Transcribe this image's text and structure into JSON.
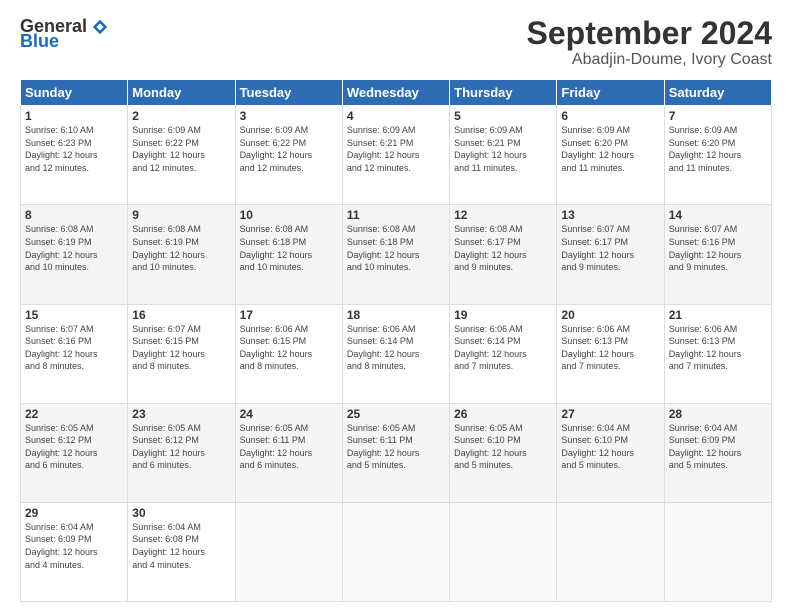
{
  "logo": {
    "general": "General",
    "blue": "Blue"
  },
  "title": "September 2024",
  "subtitle": "Abadjin-Doume, Ivory Coast",
  "days_header": [
    "Sunday",
    "Monday",
    "Tuesday",
    "Wednesday",
    "Thursday",
    "Friday",
    "Saturday"
  ],
  "weeks": [
    [
      {
        "day": "1",
        "info": "Sunrise: 6:10 AM\nSunset: 6:23 PM\nDaylight: 12 hours\nand 12 minutes."
      },
      {
        "day": "2",
        "info": "Sunrise: 6:09 AM\nSunset: 6:22 PM\nDaylight: 12 hours\nand 12 minutes."
      },
      {
        "day": "3",
        "info": "Sunrise: 6:09 AM\nSunset: 6:22 PM\nDaylight: 12 hours\nand 12 minutes."
      },
      {
        "day": "4",
        "info": "Sunrise: 6:09 AM\nSunset: 6:21 PM\nDaylight: 12 hours\nand 12 minutes."
      },
      {
        "day": "5",
        "info": "Sunrise: 6:09 AM\nSunset: 6:21 PM\nDaylight: 12 hours\nand 11 minutes."
      },
      {
        "day": "6",
        "info": "Sunrise: 6:09 AM\nSunset: 6:20 PM\nDaylight: 12 hours\nand 11 minutes."
      },
      {
        "day": "7",
        "info": "Sunrise: 6:09 AM\nSunset: 6:20 PM\nDaylight: 12 hours\nand 11 minutes."
      }
    ],
    [
      {
        "day": "8",
        "info": "Sunrise: 6:08 AM\nSunset: 6:19 PM\nDaylight: 12 hours\nand 10 minutes."
      },
      {
        "day": "9",
        "info": "Sunrise: 6:08 AM\nSunset: 6:19 PM\nDaylight: 12 hours\nand 10 minutes."
      },
      {
        "day": "10",
        "info": "Sunrise: 6:08 AM\nSunset: 6:18 PM\nDaylight: 12 hours\nand 10 minutes."
      },
      {
        "day": "11",
        "info": "Sunrise: 6:08 AM\nSunset: 6:18 PM\nDaylight: 12 hours\nand 10 minutes."
      },
      {
        "day": "12",
        "info": "Sunrise: 6:08 AM\nSunset: 6:17 PM\nDaylight: 12 hours\nand 9 minutes."
      },
      {
        "day": "13",
        "info": "Sunrise: 6:07 AM\nSunset: 6:17 PM\nDaylight: 12 hours\nand 9 minutes."
      },
      {
        "day": "14",
        "info": "Sunrise: 6:07 AM\nSunset: 6:16 PM\nDaylight: 12 hours\nand 9 minutes."
      }
    ],
    [
      {
        "day": "15",
        "info": "Sunrise: 6:07 AM\nSunset: 6:16 PM\nDaylight: 12 hours\nand 8 minutes."
      },
      {
        "day": "16",
        "info": "Sunrise: 6:07 AM\nSunset: 6:15 PM\nDaylight: 12 hours\nand 8 minutes."
      },
      {
        "day": "17",
        "info": "Sunrise: 6:06 AM\nSunset: 6:15 PM\nDaylight: 12 hours\nand 8 minutes."
      },
      {
        "day": "18",
        "info": "Sunrise: 6:06 AM\nSunset: 6:14 PM\nDaylight: 12 hours\nand 8 minutes."
      },
      {
        "day": "19",
        "info": "Sunrise: 6:06 AM\nSunset: 6:14 PM\nDaylight: 12 hours\nand 7 minutes."
      },
      {
        "day": "20",
        "info": "Sunrise: 6:06 AM\nSunset: 6:13 PM\nDaylight: 12 hours\nand 7 minutes."
      },
      {
        "day": "21",
        "info": "Sunrise: 6:06 AM\nSunset: 6:13 PM\nDaylight: 12 hours\nand 7 minutes."
      }
    ],
    [
      {
        "day": "22",
        "info": "Sunrise: 6:05 AM\nSunset: 6:12 PM\nDaylight: 12 hours\nand 6 minutes."
      },
      {
        "day": "23",
        "info": "Sunrise: 6:05 AM\nSunset: 6:12 PM\nDaylight: 12 hours\nand 6 minutes."
      },
      {
        "day": "24",
        "info": "Sunrise: 6:05 AM\nSunset: 6:11 PM\nDaylight: 12 hours\nand 6 minutes."
      },
      {
        "day": "25",
        "info": "Sunrise: 6:05 AM\nSunset: 6:11 PM\nDaylight: 12 hours\nand 5 minutes."
      },
      {
        "day": "26",
        "info": "Sunrise: 6:05 AM\nSunset: 6:10 PM\nDaylight: 12 hours\nand 5 minutes."
      },
      {
        "day": "27",
        "info": "Sunrise: 6:04 AM\nSunset: 6:10 PM\nDaylight: 12 hours\nand 5 minutes."
      },
      {
        "day": "28",
        "info": "Sunrise: 6:04 AM\nSunset: 6:09 PM\nDaylight: 12 hours\nand 5 minutes."
      }
    ],
    [
      {
        "day": "29",
        "info": "Sunrise: 6:04 AM\nSunset: 6:09 PM\nDaylight: 12 hours\nand 4 minutes."
      },
      {
        "day": "30",
        "info": "Sunrise: 6:04 AM\nSunset: 6:08 PM\nDaylight: 12 hours\nand 4 minutes."
      },
      {
        "day": "",
        "info": ""
      },
      {
        "day": "",
        "info": ""
      },
      {
        "day": "",
        "info": ""
      },
      {
        "day": "",
        "info": ""
      },
      {
        "day": "",
        "info": ""
      }
    ]
  ]
}
